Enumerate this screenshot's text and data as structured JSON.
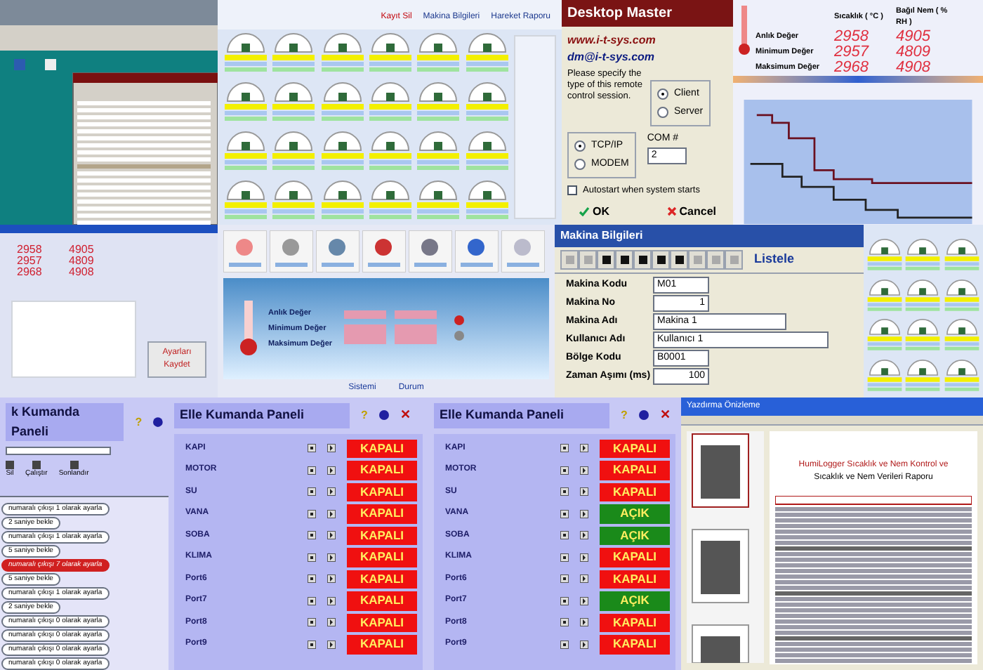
{
  "gauge_monitor": {
    "menu": [
      {
        "label": "Kayıt Sil"
      },
      {
        "label": "Makina Bilgileri"
      },
      {
        "label": "Hareket Raporu"
      }
    ]
  },
  "remote_dialog": {
    "title": "Desktop Master",
    "website": "www.i-t-sys.com",
    "email": "dm@i-t-sys.com",
    "prompt": "Please specify the type of this remote control session.",
    "session_types": [
      {
        "label": "Client",
        "selected": true
      },
      {
        "label": "Server",
        "selected": false
      }
    ],
    "connections": [
      {
        "label": "TCP/IP",
        "selected": true
      },
      {
        "label": "MODEM",
        "selected": false
      }
    ],
    "com_label": "COM #",
    "com_value": "2",
    "autostart": {
      "label": "Autostart when system starts",
      "checked": false
    },
    "buttons": [
      "OK",
      "Cancel"
    ]
  },
  "sensor_chart_window": {
    "columns": [
      "Sıcaklık ( °C )",
      "Bağıl Nem ( % RH )"
    ],
    "rows": [
      {
        "label": "Anlık Değer",
        "temperature": "2958",
        "humidity": "4905"
      },
      {
        "label": "Minimum Değer",
        "temperature": "2957",
        "humidity": "4809"
      },
      {
        "label": "Maksimum Değer",
        "temperature": "2968",
        "humidity": "4908"
      }
    ]
  },
  "settings_window": {
    "readings": [
      {
        "temperature": "2958",
        "humidity": "4905"
      },
      {
        "temperature": "2957",
        "humidity": "4809"
      },
      {
        "temperature": "2968",
        "humidity": "4908"
      }
    ],
    "save_button": "Ayarları Kaydet"
  },
  "sensor_panel": {
    "rows": [
      "Anlık Değer",
      "Minimum Değer",
      "Maksimum Değer"
    ],
    "links": [
      "Sistemi",
      "Durum"
    ]
  },
  "machine_info": {
    "title": "Makina Bilgileri",
    "list_button": "Listele",
    "fields": [
      {
        "label": "Makina Kodu",
        "value": "M01"
      },
      {
        "label": "Makina No",
        "value": "1"
      },
      {
        "label": "Makina Adı",
        "value": "Makina 1"
      },
      {
        "label": "Kullanıcı Adı",
        "value": "Kullanıcı 1"
      },
      {
        "label": "Bölge Kodu",
        "value": "B0001"
      },
      {
        "label": "Zaman Aşımı (ms)",
        "value": "100"
      }
    ]
  },
  "command_panel": {
    "title": "k Kumanda Paneli",
    "help_glyph": "?",
    "toolbar": [
      "Sil",
      "Çalıştır",
      "Sonlandır"
    ],
    "steps": [
      {
        "text": "numaralı çıkışı 1 olarak ayarla",
        "selected": false
      },
      {
        "text": "2 saniye bekle",
        "selected": false
      },
      {
        "text": "numaralı çıkışı 1 olarak ayarla",
        "selected": false
      },
      {
        "text": "5 saniye bekle",
        "selected": false
      },
      {
        "text": "numaralı çıkışı 7 olarak ayarla",
        "selected": true
      },
      {
        "text": "5 saniye bekle",
        "selected": false
      },
      {
        "text": "numaralı çıkışı 1 olarak ayarla",
        "selected": false
      },
      {
        "text": "2 saniye bekle",
        "selected": false
      },
      {
        "text": "numaralı çıkışı 0 olarak ayarla",
        "selected": false
      },
      {
        "text": "numaralı çıkışı 0 olarak ayarla",
        "selected": false
      },
      {
        "text": "numaralı çıkışı 0 olarak ayarla",
        "selected": false
      },
      {
        "text": "numaralı çıkışı 0 olarak ayarla",
        "selected": false
      }
    ]
  },
  "control_panels": [
    {
      "title": "Elle Kumanda Paneli",
      "help_glyph": "?",
      "close_glyph": "✕",
      "ports": [
        {
          "name": "KAPI",
          "on": false,
          "status": "KAPALI"
        },
        {
          "name": "MOTOR",
          "on": false,
          "status": "KAPALI"
        },
        {
          "name": "SU",
          "on": false,
          "status": "KAPALI"
        },
        {
          "name": "VANA",
          "on": false,
          "status": "KAPALI"
        },
        {
          "name": "SOBA",
          "on": false,
          "status": "KAPALI"
        },
        {
          "name": "KLIMA",
          "on": false,
          "status": "KAPALI"
        },
        {
          "name": "Port6",
          "on": false,
          "status": "KAPALI"
        },
        {
          "name": "Port7",
          "on": false,
          "status": "KAPALI"
        },
        {
          "name": "Port8",
          "on": false,
          "status": "KAPALI"
        },
        {
          "name": "Port9",
          "on": false,
          "status": "KAPALI"
        }
      ]
    },
    {
      "title": "Elle Kumanda Paneli",
      "help_glyph": "?",
      "close_glyph": "✕",
      "ports": [
        {
          "name": "KAPI",
          "on": false,
          "status": "KAPALI"
        },
        {
          "name": "MOTOR",
          "on": false,
          "status": "KAPALI"
        },
        {
          "name": "SU",
          "on": false,
          "status": "KAPALI"
        },
        {
          "name": "VANA",
          "on": true,
          "status": "AÇIK"
        },
        {
          "name": "SOBA",
          "on": true,
          "status": "AÇIK"
        },
        {
          "name": "KLIMA",
          "on": false,
          "status": "KAPALI"
        },
        {
          "name": "Port6",
          "on": false,
          "status": "KAPALI"
        },
        {
          "name": "Port7",
          "on": true,
          "status": "AÇIK"
        },
        {
          "name": "Port8",
          "on": false,
          "status": "KAPALI"
        },
        {
          "name": "Port9",
          "on": false,
          "status": "KAPALI"
        }
      ]
    }
  ],
  "print_preview": {
    "title": "Yazdırma Önizleme",
    "report_title": "HumiLogger Sıcaklık ve Nem Kontrol ve",
    "report_subtitle": "Sıcaklık ve Nem Verileri Raporu"
  }
}
